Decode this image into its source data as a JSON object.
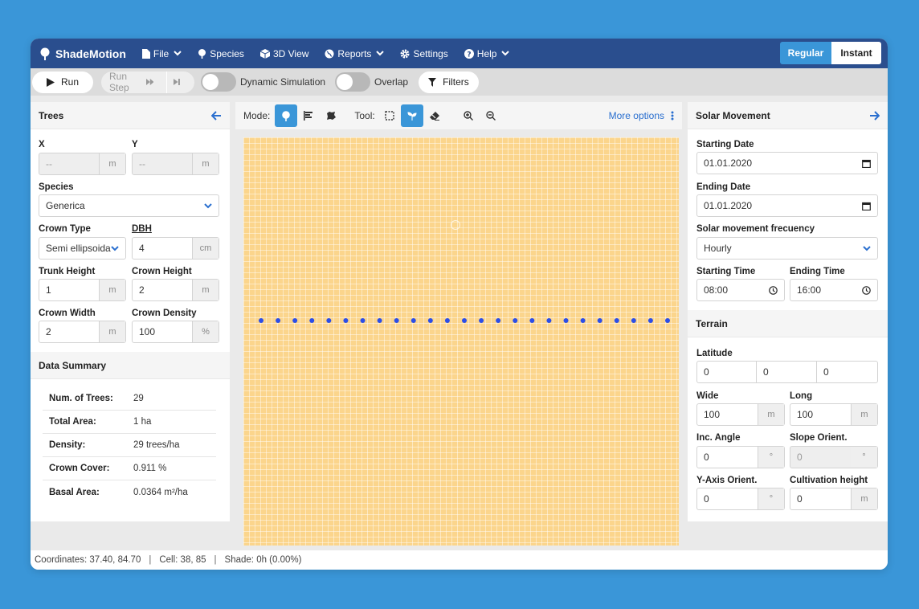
{
  "navbar": {
    "brand": "ShadeMotion",
    "items": [
      {
        "label": "File",
        "icon": "file-icon",
        "dropdown": true
      },
      {
        "label": "Species",
        "icon": "tree-icon",
        "dropdown": false
      },
      {
        "label": "3D View",
        "icon": "cube-icon",
        "dropdown": false
      },
      {
        "label": "Reports",
        "icon": "globe-icon",
        "dropdown": true
      },
      {
        "label": "Settings",
        "icon": "gear-icon",
        "dropdown": false
      },
      {
        "label": "Help",
        "icon": "help-icon",
        "dropdown": true
      }
    ],
    "mode_regular": "Regular",
    "mode_instant": "Instant"
  },
  "toolbar": {
    "run": "Run",
    "run_step": "Run Step",
    "dynamic_simulation": "Dynamic Simulation",
    "overlap": "Overlap",
    "filters": "Filters"
  },
  "trees_panel": {
    "title": "Trees",
    "x_label": "X",
    "x_value": "--",
    "x_unit": "m",
    "y_label": "Y",
    "y_value": "--",
    "y_unit": "m",
    "species_label": "Species",
    "species_value": "Generica",
    "crown_type_label": "Crown Type",
    "crown_type_value": "Semi ellipsoidal",
    "dbh_label": "DBH",
    "dbh_value": "4",
    "dbh_unit": "cm",
    "trunk_height_label": "Trunk Height",
    "trunk_height_value": "1",
    "trunk_height_unit": "m",
    "crown_height_label": "Crown Height",
    "crown_height_value": "2",
    "crown_height_unit": "m",
    "crown_width_label": "Crown Width",
    "crown_width_value": "2",
    "crown_width_unit": "m",
    "crown_density_label": "Crown Density",
    "crown_density_value": "100",
    "crown_density_unit": "%"
  },
  "data_summary": {
    "title": "Data Summary",
    "rows": [
      {
        "key": "Num. of Trees:",
        "value": "29"
      },
      {
        "key": "Total Area:",
        "value": "1 ha"
      },
      {
        "key": "Density:",
        "value": "29 trees/ha"
      },
      {
        "key": "Crown Cover:",
        "value": "0.911 %"
      },
      {
        "key": "Basal Area:",
        "value": "0.0364 m²/ha"
      }
    ]
  },
  "canvas": {
    "mode_label": "Mode:",
    "tool_label": "Tool:",
    "more_options": "More options",
    "grid_color": "#fbd58c",
    "tree_color": "#2b4ee8",
    "tree_count": 25
  },
  "solar_panel": {
    "title": "Solar Movement",
    "starting_date_label": "Starting Date",
    "starting_date_value": "01.01.2020",
    "ending_date_label": "Ending Date",
    "ending_date_value": "01.01.2020",
    "frequency_label": "Solar movement frecuency",
    "frequency_value": "Hourly",
    "starting_time_label": "Starting Time",
    "starting_time_value": "08:00",
    "ending_time_label": "Ending Time",
    "ending_time_value": "16:00"
  },
  "terrain_panel": {
    "title": "Terrain",
    "latitude_label": "Latitude",
    "lat_deg": "0",
    "lat_min": "0",
    "lat_sec": "0",
    "wide_label": "Wide",
    "wide_value": "100",
    "wide_unit": "m",
    "long_label": "Long",
    "long_value": "100",
    "long_unit": "m",
    "inc_angle_label": "Inc. Angle",
    "inc_angle_value": "0",
    "inc_angle_unit": "°",
    "slope_label": "Slope Orient.",
    "slope_value": "0",
    "slope_unit": "°",
    "y_axis_label": "Y-Axis Orient.",
    "y_axis_value": "0",
    "y_axis_unit": "°",
    "cultivation_label": "Cultivation height",
    "cultivation_value": "0",
    "cultivation_unit": "m"
  },
  "status": {
    "coordinates": "Coordinates: 37.40, 84.70",
    "cell": "Cell: 38, 85",
    "shade": "Shade: 0h (0.00%)"
  },
  "colors": {
    "navbar": "#2a4e8e",
    "accent": "#3a96d8",
    "background": "#3a96d8"
  }
}
